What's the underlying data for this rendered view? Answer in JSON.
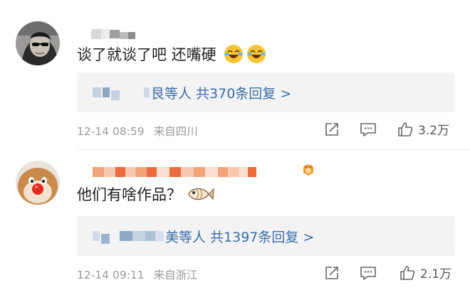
{
  "comments": [
    {
      "text": "谈了就谈了吧 还嘴硬",
      "emojis": [
        "laugh-cry-emoji",
        "laugh-cry-emoji"
      ],
      "reply_summary": "艮等人 共370条回复 >",
      "time": "12-14 08:59",
      "location": "来自四川",
      "like_count": "3.2万",
      "avatar": "man-sunglasses-avatar"
    },
    {
      "text": "他们有啥作品？",
      "emojis": [
        "fish-emoji"
      ],
      "reply_summary": "美等人 共1397条回复 >",
      "time": "12-14 09:11",
      "location": "来自浙江",
      "like_count": "2.1万",
      "avatar": "cartoon-dog-avatar",
      "badge": "level-badge"
    }
  ],
  "icons": {
    "share": "share-icon",
    "comment": "comment-icon",
    "like": "thumbs-up-icon"
  },
  "colors": {
    "link": "#3a6ea8",
    "meta": "#9a9a9a",
    "reply_bg": "#f3f3f4"
  }
}
